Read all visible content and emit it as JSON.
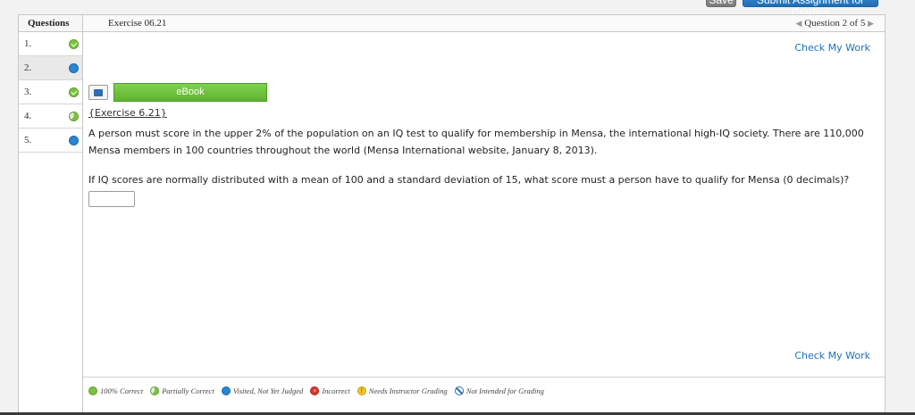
{
  "toolbar": {
    "save_label": "Save",
    "submit_label": "Submit Assignment for Grading"
  },
  "sidebar": {
    "header": "Questions",
    "questions": [
      {
        "number": "1.",
        "status": "correct"
      },
      {
        "number": "2.",
        "status": "visited",
        "active": true
      },
      {
        "number": "3.",
        "status": "correct"
      },
      {
        "number": "4.",
        "status": "partial"
      },
      {
        "number": "5.",
        "status": "visited"
      }
    ]
  },
  "topbar": {
    "exercise_title": "Exercise 06.21",
    "question_nav": "Question 2 of 5"
  },
  "content": {
    "check_my_work": "Check My Work",
    "ebook_label": "eBook",
    "exercise_ref": "{Exercise 6.21}",
    "prompt": "A person must score in the upper 2% of the population on an IQ test to qualify for membership in Mensa, the international high-IQ society. There are 110,000 Mensa members in 100 countries throughout the world (Mensa International website, January 8, 2013).",
    "question": "If IQ scores are normally distributed with a mean of 100 and a standard deviation of 15, what score must a person have to qualify for Mensa (0 decimals)?",
    "answer_value": ""
  },
  "legend": {
    "items": [
      {
        "label": "100% Correct",
        "icon": "correct-icon"
      },
      {
        "label": "Partially Correct",
        "icon": "partial-icon"
      },
      {
        "label": "Visited, Not Yet Judged",
        "icon": "visited-icon"
      },
      {
        "label": "Incorrect",
        "icon": "incorrect-icon"
      },
      {
        "label": "Needs Instructor Grading",
        "icon": "instructor-icon"
      },
      {
        "label": "Not Intended for Grading",
        "icon": "not-graded-icon"
      }
    ]
  },
  "colors": {
    "accent_blue": "#1f6fb8",
    "ebook_green": "#6cc23a",
    "correct_green": "#7cc242",
    "visited_blue": "#2a86d3"
  }
}
